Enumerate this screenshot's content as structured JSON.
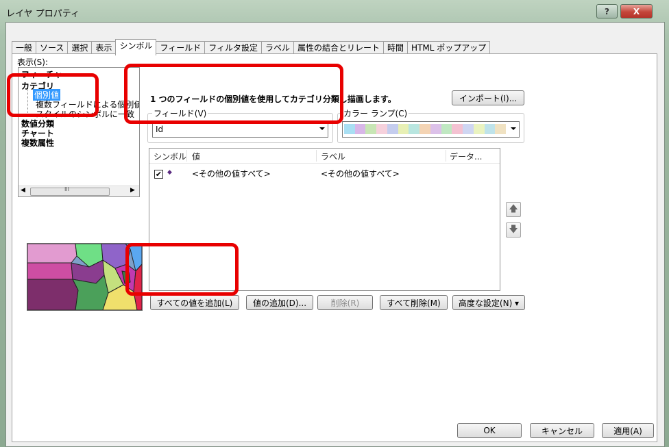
{
  "window": {
    "title": "レイヤ プロパティ",
    "help_label": "?",
    "close_label": "X"
  },
  "tabs": [
    {
      "label": "一般"
    },
    {
      "label": "ソース"
    },
    {
      "label": "選択"
    },
    {
      "label": "表示"
    },
    {
      "label": "シンボル"
    },
    {
      "label": "フィールド"
    },
    {
      "label": "フィルタ設定"
    },
    {
      "label": "ラベル"
    },
    {
      "label": "属性の結合とリレート"
    },
    {
      "label": "時間"
    },
    {
      "label": "HTML ポップアップ"
    }
  ],
  "show": {
    "label": "表示(S):",
    "tree": [
      {
        "label": "フィーチャ"
      },
      {
        "label": "カテゴリ"
      },
      {
        "label": "個別値"
      },
      {
        "label": "複数フィールドによる個別値"
      },
      {
        "label": "スタイルのシンボルに一致"
      },
      {
        "label": "数値分類"
      },
      {
        "label": "チャート"
      },
      {
        "label": "複数属性"
      }
    ],
    "scroll_label": "III"
  },
  "description": "1 つのフィールドの個別値を使用してカテゴリ分類し描画します。",
  "import_button": "インポート(I)...",
  "field": {
    "group_label": "フィールド(V)",
    "value": "Id"
  },
  "color_ramp": {
    "group_label": "カラー ランプ(C)",
    "colors": [
      "#a9dff3",
      "#d8b7e8",
      "#c8e6b5",
      "#f6d1dc",
      "#c5cdee",
      "#e8f0b5",
      "#b9e6e0",
      "#f4d4b4",
      "#dcc1e9",
      "#c0e8c2",
      "#f4c2d2",
      "#cfd6f2",
      "#eaf3c0",
      "#bfe3ea",
      "#f0e2c2"
    ]
  },
  "table": {
    "headers": [
      "シンボル",
      "値",
      "ラベル",
      "データ..."
    ],
    "rows": [
      {
        "checked": "✔",
        "symbol": "◆",
        "value": "<その他の値すべて>",
        "label": "<その他の値すべて>"
      }
    ]
  },
  "buttons": {
    "add_all": "すべての値を追加(L)",
    "add_values": "値の追加(D)...",
    "remove": "削除(R)",
    "remove_all": "すべて削除(M)",
    "advanced": "高度な設定(N) ▾",
    "up": "🡅",
    "down": "🡇"
  },
  "footer": {
    "ok": "OK",
    "cancel": "キャンセル",
    "apply": "適用(A)"
  },
  "colors": {
    "highlight": "#e80000",
    "selection": "#3399ff"
  }
}
